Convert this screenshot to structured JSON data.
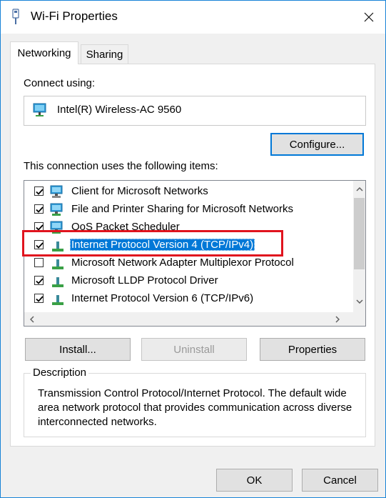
{
  "window": {
    "title": "Wi-Fi Properties"
  },
  "tabs": [
    {
      "label": "Networking",
      "active": true
    },
    {
      "label": "Sharing",
      "active": false
    }
  ],
  "connect_using": {
    "label": "Connect using:",
    "adapter": "Intel(R) Wireless-AC 9560",
    "adapter_icon": "network-adapter-icon"
  },
  "configure_button": "Configure...",
  "items_label": "This connection uses the following items:",
  "items": [
    {
      "label": "Client for Microsoft Networks",
      "checked": true,
      "icon": "network-client-icon"
    },
    {
      "label": "File and Printer Sharing for Microsoft Networks",
      "checked": true,
      "icon": "network-service-icon"
    },
    {
      "label": "QoS Packet Scheduler",
      "checked": true,
      "icon": "network-service-icon"
    },
    {
      "label": "Internet Protocol Version 4 (TCP/IPv4)",
      "checked": true,
      "selected": true,
      "icon": "network-protocol-icon"
    },
    {
      "label": "Microsoft Network Adapter Multiplexor Protocol",
      "checked": false,
      "icon": "network-protocol-icon"
    },
    {
      "label": "Microsoft LLDP Protocol Driver",
      "checked": true,
      "icon": "network-protocol-icon"
    },
    {
      "label": "Internet Protocol Version 6 (TCP/IPv6)",
      "checked": true,
      "icon": "network-protocol-icon"
    }
  ],
  "buttons": {
    "install": "Install...",
    "uninstall": "Uninstall",
    "properties": "Properties",
    "ok": "OK",
    "cancel": "Cancel"
  },
  "description": {
    "legend": "Description",
    "text": "Transmission Control Protocol/Internet Protocol. The default wide area network protocol that provides communication across diverse interconnected networks."
  },
  "colors": {
    "accent": "#0078d7",
    "highlight_box": "#e0141e",
    "window_border": "#1883d7"
  }
}
